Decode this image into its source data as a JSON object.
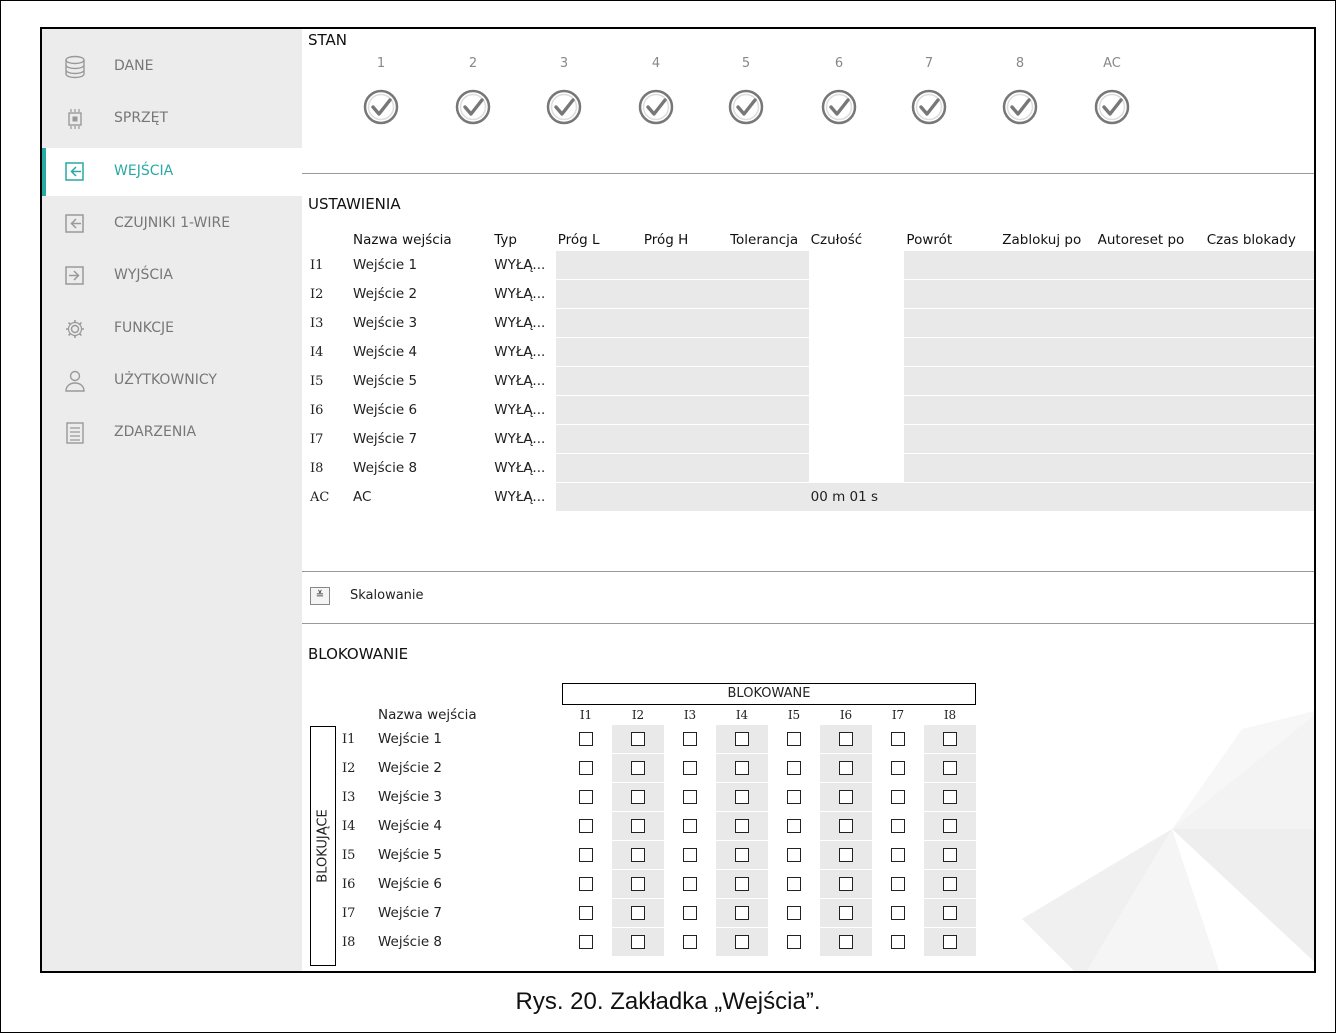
{
  "sidebar": {
    "items": [
      {
        "label": "DANE",
        "icon": "database-icon",
        "active": false
      },
      {
        "label": "SPRZĘT",
        "icon": "chip-icon",
        "active": false
      },
      {
        "label": "WEJŚCIA",
        "icon": "input-icon",
        "active": true
      },
      {
        "label": "CZUJNIKI 1-WIRE",
        "icon": "input-icon",
        "active": false
      },
      {
        "label": "WYJŚCIA",
        "icon": "output-icon",
        "active": false
      },
      {
        "label": "FUNKCJE",
        "icon": "gear-icon",
        "active": false
      },
      {
        "label": "UŻYTKOWNICY",
        "icon": "user-icon",
        "active": false
      },
      {
        "label": "ZDARZENIA",
        "icon": "document-icon",
        "active": false
      }
    ]
  },
  "stan": {
    "title": "STAN",
    "columns": [
      "1",
      "2",
      "3",
      "4",
      "5",
      "6",
      "7",
      "8",
      "AC"
    ]
  },
  "ustawienia": {
    "title": "USTAWIENIA",
    "headers": [
      "",
      "Nazwa wejścia",
      "Typ",
      "Próg L",
      "Próg H",
      "Tolerancja",
      "Czułość",
      "Powrót",
      "Zablokuj po",
      "Autoreset po",
      "Czas blokady"
    ],
    "rows": [
      {
        "id": "I1",
        "name": "Wejście 1",
        "type": "WYŁĄ...",
        "czulosc": ""
      },
      {
        "id": "I2",
        "name": "Wejście 2",
        "type": "WYŁĄ...",
        "czulosc": ""
      },
      {
        "id": "I3",
        "name": "Wejście 3",
        "type": "WYŁĄ...",
        "czulosc": ""
      },
      {
        "id": "I4",
        "name": "Wejście 4",
        "type": "WYŁĄ...",
        "czulosc": ""
      },
      {
        "id": "I5",
        "name": "Wejście 5",
        "type": "WYŁĄ...",
        "czulosc": ""
      },
      {
        "id": "I6",
        "name": "Wejście 6",
        "type": "WYŁĄ...",
        "czulosc": ""
      },
      {
        "id": "I7",
        "name": "Wejście 7",
        "type": "WYŁĄ...",
        "czulosc": ""
      },
      {
        "id": "I8",
        "name": "Wejście 8",
        "type": "WYŁĄ...",
        "czulosc": ""
      },
      {
        "id": "AC",
        "name": "AC",
        "type": "WYŁĄ...",
        "czulosc": "00 m 01 s"
      }
    ]
  },
  "skalowanie": {
    "label": "Skalowanie"
  },
  "blokowanie": {
    "title": "BLOKOWANIE",
    "blokowane_label": "BLOKOWANE",
    "blokujace_label": "BLOKUJĄCE",
    "name_header": "Nazwa wejścia",
    "columns": [
      "I1",
      "I2",
      "I3",
      "I4",
      "I5",
      "I6",
      "I7",
      "I8"
    ],
    "rows": [
      {
        "id": "I1",
        "name": "Wejście 1"
      },
      {
        "id": "I2",
        "name": "Wejście 2"
      },
      {
        "id": "I3",
        "name": "Wejście 3"
      },
      {
        "id": "I4",
        "name": "Wejście 4"
      },
      {
        "id": "I5",
        "name": "Wejście 5"
      },
      {
        "id": "I6",
        "name": "Wejście 6"
      },
      {
        "id": "I7",
        "name": "Wejście 7"
      },
      {
        "id": "I8",
        "name": "Wejście 8"
      }
    ]
  },
  "caption": "Rys. 20. Zakładka „Wejścia”.",
  "colors": {
    "accent": "#29a9a4",
    "sidebar_bg": "#ececec",
    "cell_gray": "#e9e9e9"
  }
}
